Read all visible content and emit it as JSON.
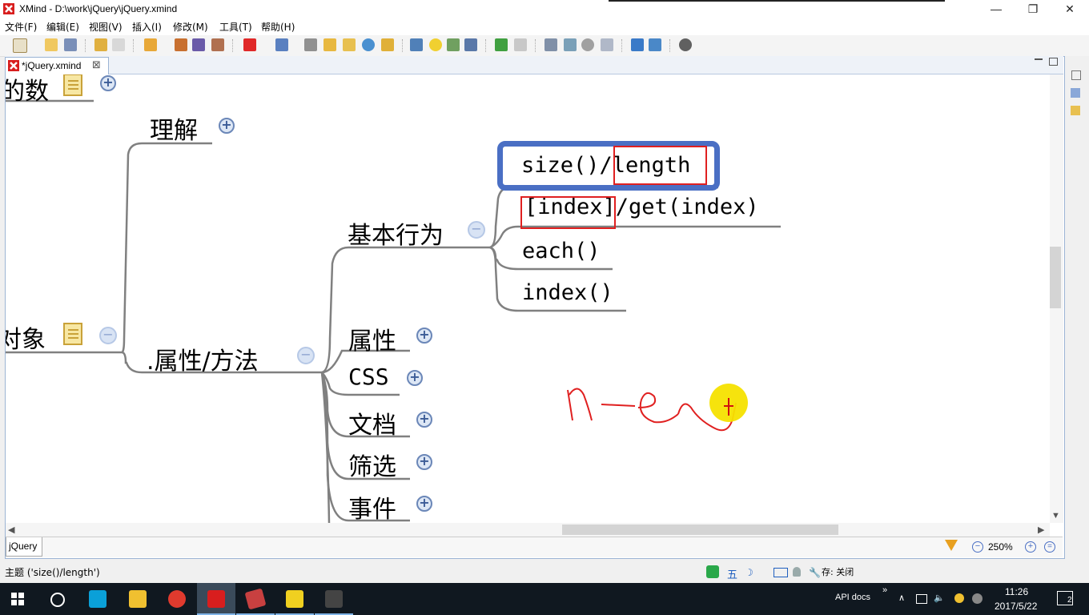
{
  "window": {
    "title": "XMind - D:\\work\\jQuery\\jQuery.xmind",
    "minimize": "—",
    "restore": "❐",
    "close": "✕"
  },
  "menu": [
    "文件(F)",
    "编辑(E)",
    "视图(V)",
    "插入(I)",
    "修改(M)",
    "工具(T)",
    "帮助(H)"
  ],
  "editor": {
    "tab_label": "*jQuery.xmind",
    "tab_close": "⊠"
  },
  "mindmap": {
    "partial_top": "的数",
    "partial_left": "对象",
    "branch_understand": "理解",
    "branch_attr_method": ".属性/方法",
    "basic_behavior": "基本行为",
    "size_length": {
      "part1": "size()/",
      "part2": "length"
    },
    "index_get": {
      "part1": "[index]",
      "part2": "/get(index)"
    },
    "each": "each()",
    "index_fn": "index()",
    "attr": "属性",
    "css": "CSS",
    "doc": "文档",
    "filter": "筛选",
    "event": "事件",
    "handwriting": "n-ew"
  },
  "sheetbar": {
    "sheet_tab": "jQuery",
    "zoom": "250%"
  },
  "status": {
    "topic": "主题 ('size()/length')",
    "ime": "五",
    "save_state": "存: 关闭"
  },
  "taskbar": {
    "apps": [
      "WebStorm",
      "File Explorer",
      "Chrome",
      "XMind",
      "App",
      "Help",
      "Terminal"
    ],
    "tray_label": "API docs",
    "tray_expand": "»",
    "time": "11:26",
    "date": "2017/5/22",
    "notifications": "2"
  },
  "colors": {
    "accent_blue": "#4a6fc4",
    "red_box": "#e02020",
    "line": "#808080",
    "cursor": "#f5e200"
  }
}
